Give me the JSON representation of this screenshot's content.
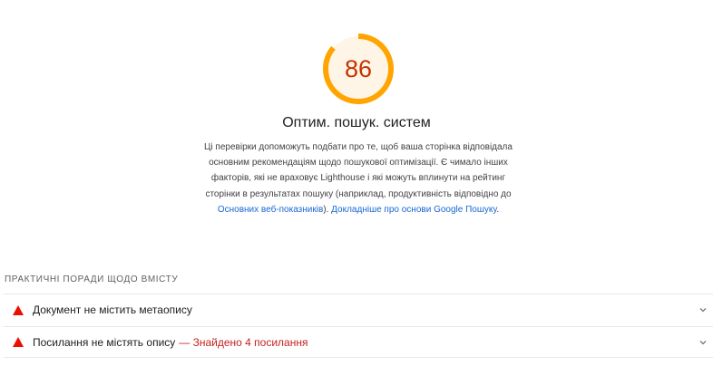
{
  "category": {
    "score": "86",
    "score_fraction": 0.86,
    "score_color": "#ffa400",
    "score_text_color": "#c33300",
    "title": "Оптим. пошук. систем",
    "description_text": "Ці перевірки допоможуть подбати про те, щоб ваша сторінка відповідала основним рекомендаціям щодо пошукової оптимізації. Є чимало інших факторів, які не враховує Lighthouse і які можуть вплинути на рейтинг сторінки в результатах пошуку (наприклад, продуктивність відповідно до ",
    "description_link_1": "Основних веб-показників",
    "description_between": "). ",
    "description_link_2": "Докладніше про основи Google Пошуку",
    "description_end": "."
  },
  "group": {
    "title": "ПРАКТИЧНІ ПОРАДИ ЩОДО ВМІСТУ"
  },
  "audits": [
    {
      "title": "Документ не містить метаопису",
      "display_value": "",
      "status_icon": "fail-triangle-icon",
      "expand_icon": "chevron-down-icon"
    },
    {
      "title": "Посилання не містять опису",
      "display_value": "— Знайдено 4 посилання",
      "status_icon": "fail-triangle-icon",
      "expand_icon": "chevron-down-icon"
    }
  ],
  "colors": {
    "fail": "#eb0f00",
    "fail_text": "#c5221f",
    "link": "#1967d2",
    "gauge_bg": "#fff3e0"
  }
}
